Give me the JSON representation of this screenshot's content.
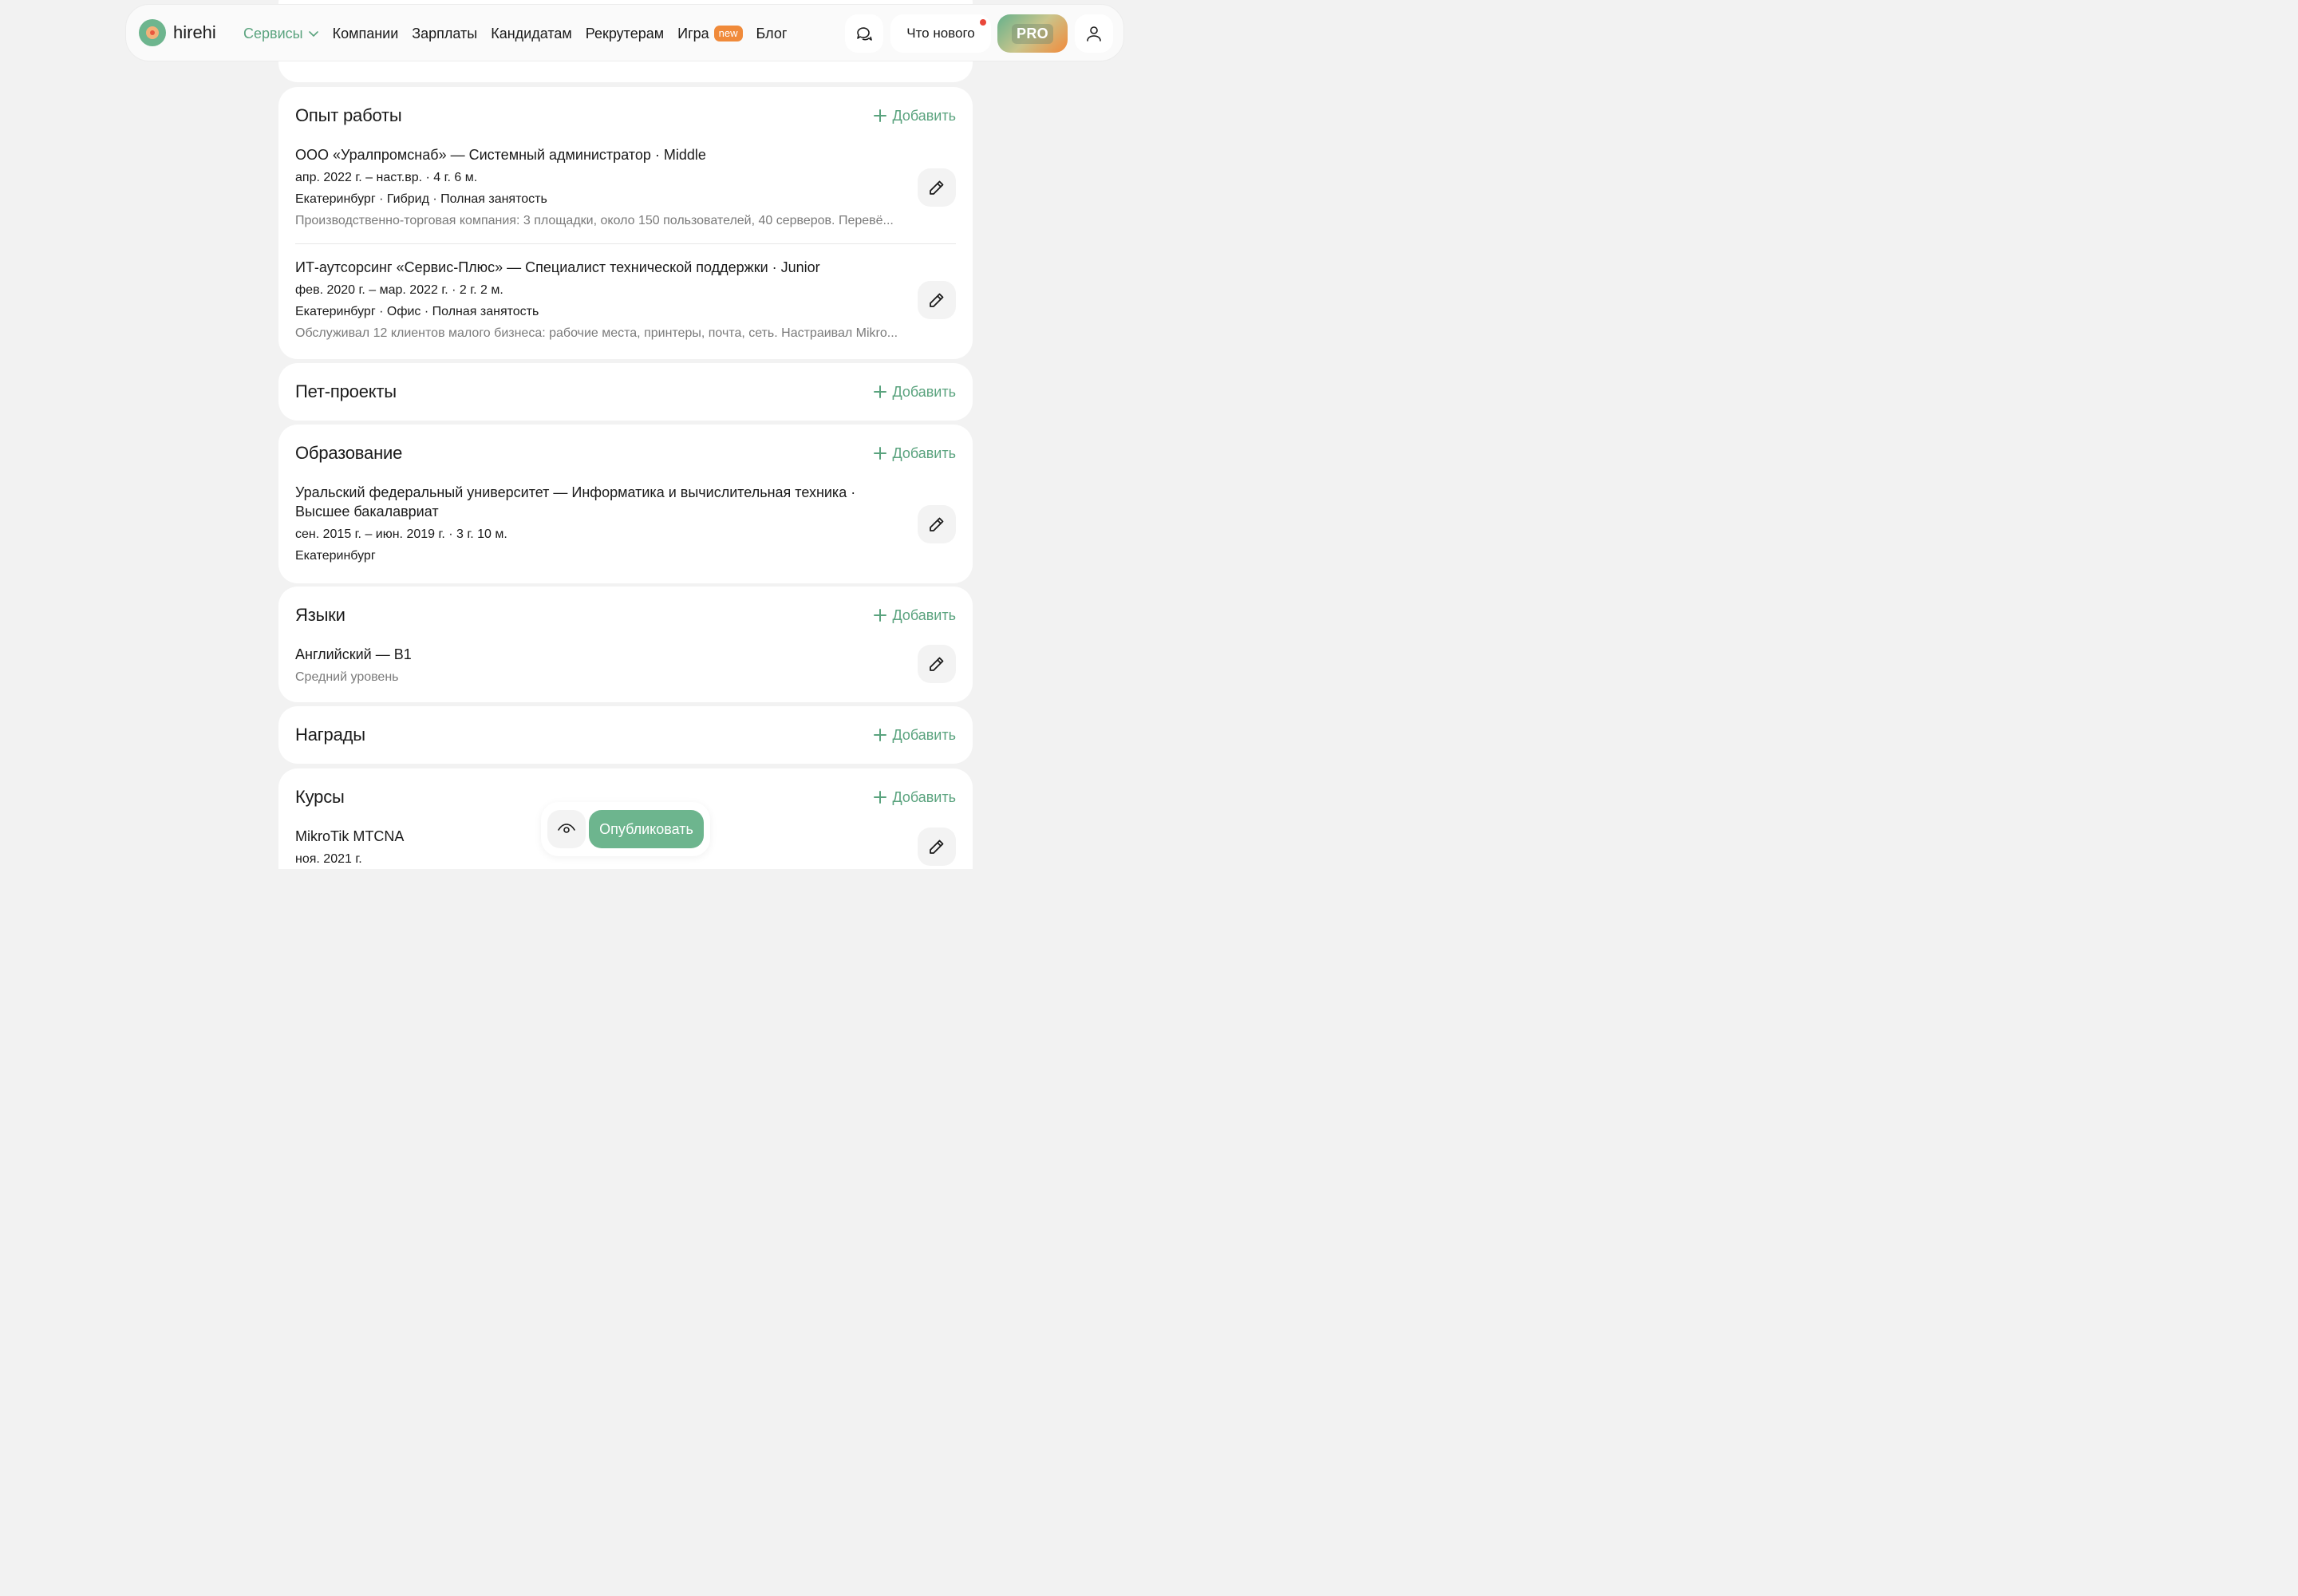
{
  "header": {
    "logo_text": "hirehi",
    "nav": [
      {
        "label": "Сервисы"
      },
      {
        "label": "Компании"
      },
      {
        "label": "Зарплаты"
      },
      {
        "label": "Кандидатам"
      },
      {
        "label": "Рекрутерам"
      },
      {
        "label": "Игра",
        "badge": "new"
      },
      {
        "label": "Блог"
      }
    ],
    "whats_new_label": "Что нового",
    "pro_label": "PRO"
  },
  "add_label": "Добавить",
  "experience": {
    "title": "Опыт работы",
    "items": [
      {
        "title": "ООО «Уралпромснаб» — Системный администратор · Middle",
        "period": "апр. 2022 г. – наст.вр. · 4 г. 6 м.",
        "details": "Екатеринбург · Гибрид · Полная занятость",
        "description": "Производственно-торговая компания: 3 площадки, около 150 пользователей, 40 серверов. Перевё..."
      },
      {
        "title": "ИТ-аутсорсинг «Сервис-Плюс» — Специалист технической поддержки · Junior",
        "period": "фев. 2020 г. – мар. 2022 г. · 2 г. 2 м.",
        "details": "Екатеринбург · Офис · Полная занятость",
        "description": "Обслуживал 12 клиентов малого бизнеса: рабочие места, принтеры, почта, сеть. Настраивал Mikro..."
      }
    ]
  },
  "pet_projects": {
    "title": "Пет-проекты"
  },
  "education": {
    "title": "Образование",
    "items": [
      {
        "title_line1": "Уральский федеральный университет — Информатика и вычислительная техника ·",
        "title_line2": "Высшее бакалавриат",
        "period": "сен. 2015 г. – июн. 2019 г. · 3 г. 10 м.",
        "details": "Екатеринбург"
      }
    ]
  },
  "languages": {
    "title": "Языки",
    "items": [
      {
        "title": "Английский — B1",
        "level": "Средний уровень"
      }
    ]
  },
  "awards": {
    "title": "Награды"
  },
  "courses": {
    "title": "Курсы",
    "items": [
      {
        "title": "MikroTik MTCNA",
        "period": "ноя. 2021 г."
      }
    ]
  },
  "bottom_bar": {
    "publish_label": "Опубликовать"
  },
  "colors": {
    "accent": "#6db58e",
    "accent_text": "#5aa37e",
    "badge": "#f08a3a",
    "notification": "#e9473a"
  }
}
